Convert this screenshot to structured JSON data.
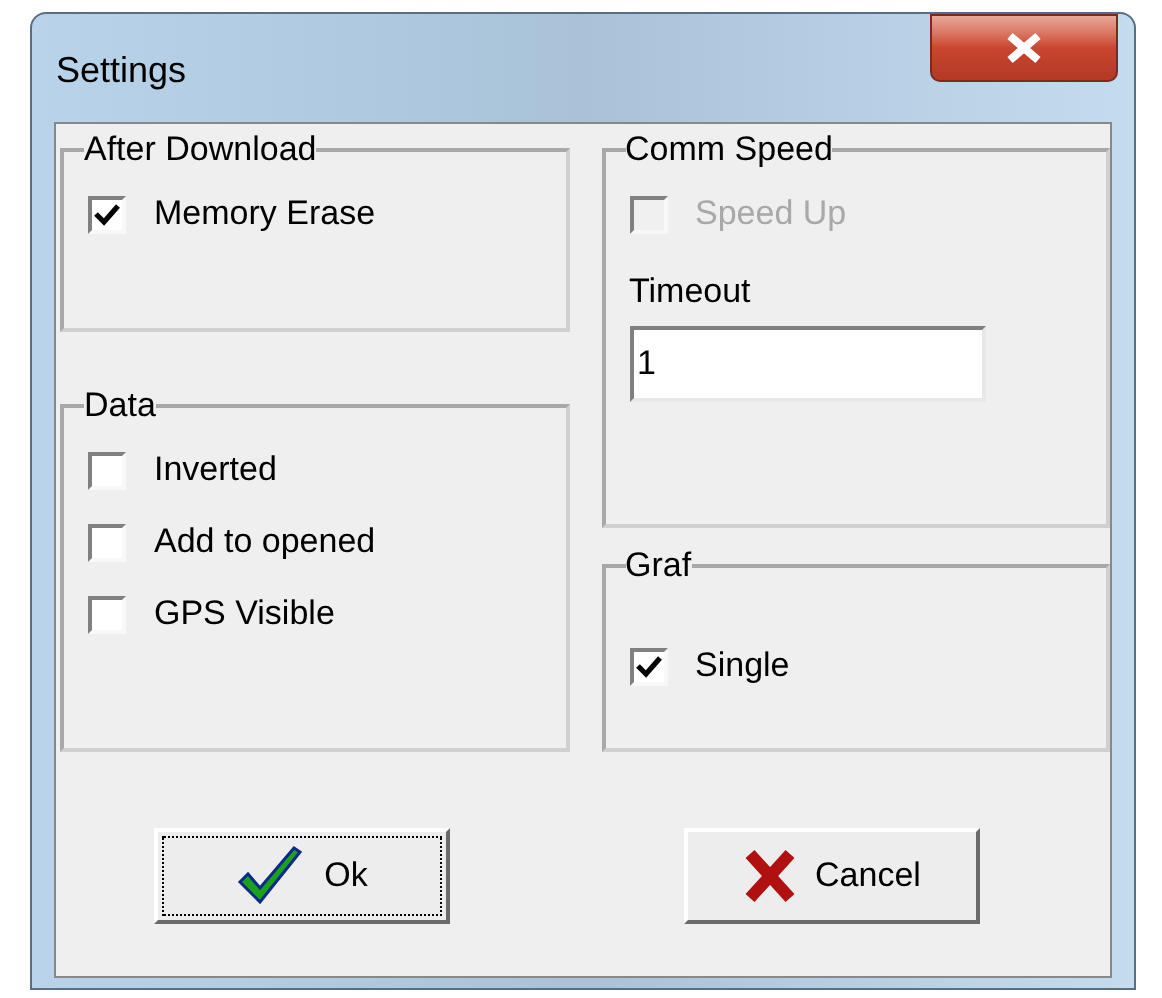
{
  "window": {
    "title": "Settings"
  },
  "columns": [
    [
      {
        "title": "After Download",
        "items": [
          {
            "kind": "checkbox",
            "label": "Memory Erase",
            "checked": true,
            "disabled": false
          }
        ]
      },
      {
        "title": "Data",
        "items": [
          {
            "kind": "checkbox",
            "label": "Inverted",
            "checked": false,
            "disabled": false
          },
          {
            "kind": "checkbox",
            "label": "Add to opened",
            "checked": false,
            "disabled": false
          },
          {
            "kind": "checkbox",
            "label": "GPS Visible",
            "checked": false,
            "disabled": false
          }
        ]
      }
    ],
    [
      {
        "title": "Comm Speed",
        "items": [
          {
            "kind": "checkbox",
            "label": "Speed Up",
            "checked": false,
            "disabled": true
          },
          {
            "kind": "field",
            "label": "Timeout",
            "value": "1"
          }
        ]
      },
      {
        "title": "Graf",
        "items": [
          {
            "kind": "checkbox",
            "label": "Single",
            "checked": true,
            "disabled": false
          }
        ]
      }
    ]
  ],
  "buttons": [
    {
      "kind": "ok",
      "label": "Ok",
      "focused": true
    },
    {
      "kind": "cancel",
      "label": "Cancel",
      "focused": false
    }
  ]
}
